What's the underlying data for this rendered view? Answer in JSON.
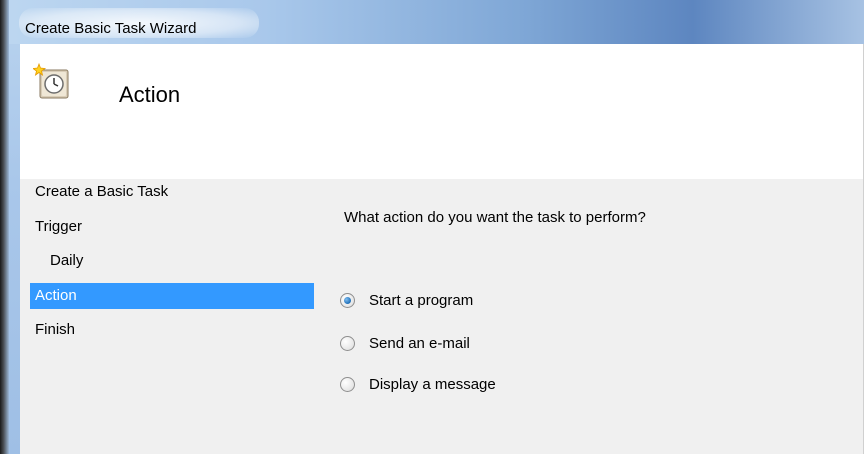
{
  "window": {
    "title": "Create Basic Task Wizard"
  },
  "header": {
    "title": "Action",
    "icon": "task-scheduler-clock-icon"
  },
  "nav": {
    "items": [
      {
        "label": "Create a Basic Task",
        "selected": false,
        "sub": false
      },
      {
        "label": "Trigger",
        "selected": false,
        "sub": false
      },
      {
        "label": "Daily",
        "selected": false,
        "sub": true
      },
      {
        "label": "Action",
        "selected": true,
        "sub": false
      },
      {
        "label": "Finish",
        "selected": false,
        "sub": false
      }
    ]
  },
  "main": {
    "question": "What action do you want the task to perform?",
    "options": [
      {
        "label": "Start a program",
        "checked": true
      },
      {
        "label": "Send an e-mail",
        "checked": false
      },
      {
        "label": "Display a message",
        "checked": false
      }
    ]
  },
  "colors": {
    "selection": "#3399ff",
    "panel": "#f0f0f0",
    "header": "#ffffff"
  }
}
